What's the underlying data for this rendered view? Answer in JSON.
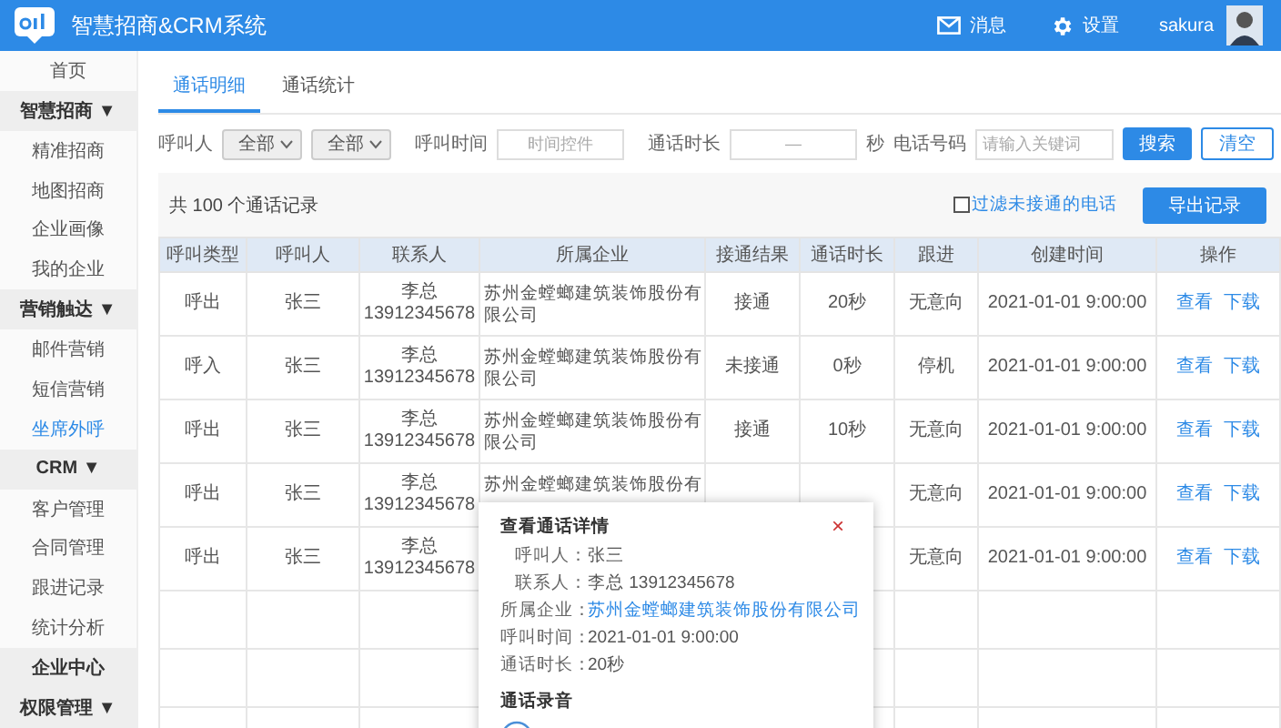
{
  "header": {
    "title": "智慧招商&CRM系统",
    "messages": "消息",
    "settings": "设置",
    "user": "sakura"
  },
  "sidebar": {
    "items": [
      {
        "label": "首页",
        "kind": "item",
        "selected": false
      },
      {
        "label": "智慧招商 ▼",
        "kind": "group",
        "selected": false
      },
      {
        "label": "精准招商",
        "kind": "item",
        "selected": false
      },
      {
        "label": "地图招商",
        "kind": "item",
        "selected": false
      },
      {
        "label": "企业画像",
        "kind": "item",
        "selected": false
      },
      {
        "label": "我的企业",
        "kind": "item",
        "selected": false
      },
      {
        "label": "营销触达 ▼",
        "kind": "group",
        "selected": false
      },
      {
        "label": "邮件营销",
        "kind": "item",
        "selected": false
      },
      {
        "label": "短信营销",
        "kind": "item",
        "selected": false
      },
      {
        "label": "坐席外呼",
        "kind": "item",
        "selected": true
      },
      {
        "label": "CRM ▼",
        "kind": "group",
        "selected": false
      },
      {
        "label": "客户管理",
        "kind": "item",
        "selected": false
      },
      {
        "label": "合同管理",
        "kind": "item",
        "selected": false
      },
      {
        "label": "跟进记录",
        "kind": "item",
        "selected": false
      },
      {
        "label": "统计分析",
        "kind": "item",
        "selected": false
      },
      {
        "label": "企业中心",
        "kind": "group",
        "selected": false
      },
      {
        "label": "权限管理 ▼",
        "kind": "group",
        "selected": false
      }
    ]
  },
  "tabs": [
    {
      "label": "通话明细",
      "selected": true
    },
    {
      "label": "通话统计",
      "selected": false
    }
  ],
  "filters": {
    "caller_label": "呼叫人",
    "select_1": "全部",
    "select_2": "全部",
    "time_label": "呼叫时间",
    "time_placeholder": "时间控件",
    "duration_label": "通话时长",
    "duration_placeholder": "—",
    "duration_unit": "秒",
    "phone_label": "电话号码",
    "phone_placeholder": "请输入关键词",
    "search": "搜索",
    "clear": "清空"
  },
  "summary": {
    "count": "共 100 个通话记录",
    "filter_unanswered": {
      "label": "过滤未接通的电话",
      "checked": false
    },
    "export": "导出记录"
  },
  "table": {
    "columns": [
      "呼叫类型",
      "呼叫人",
      "联系人",
      "所属企业",
      "接通结果",
      "通话时长",
      "跟进",
      "创建时间",
      "操作"
    ],
    "rows": [
      {
        "type": "呼出",
        "caller": "张三",
        "contact": "李总",
        "phone": "13912345678",
        "company": "苏州金螳螂建筑装饰股份有限公司",
        "result": "接通",
        "duration": "20秒",
        "follow": "无意向",
        "time": "2021-01-01  9:00:00",
        "actions": [
          "查看",
          "下载"
        ]
      },
      {
        "type": "呼入",
        "caller": "张三",
        "contact": "李总",
        "phone": "13912345678",
        "company": "苏州金螳螂建筑装饰股份有限公司",
        "result": "未接通",
        "duration": "0秒",
        "follow": "停机",
        "time": "2021-01-01  9:00:00",
        "actions": [
          "查看",
          "下载"
        ]
      },
      {
        "type": "呼出",
        "caller": "张三",
        "contact": "李总",
        "phone": "13912345678",
        "company": "苏州金螳螂建筑装饰股份有限公司",
        "result": "接通",
        "duration": "10秒",
        "follow": "无意向",
        "time": "2021-01-01  9:00:00",
        "actions": [
          "查看",
          "下载"
        ]
      },
      {
        "type": "呼出",
        "caller": "张三",
        "contact": "李总",
        "phone": "13912345678",
        "company": "苏州金螳螂建筑装饰股份有",
        "follow": "无意向",
        "time": "2021-01-01  9:00:00",
        "actions": [
          "查看",
          "下载"
        ]
      },
      {
        "type": "呼出",
        "caller": "张三",
        "contact": "李总",
        "phone": "13912345678",
        "follow": "无意向",
        "time": "2021-01-01  9:00:00",
        "actions": [
          "查看",
          "下载"
        ]
      }
    ]
  },
  "popup": {
    "title": "查看通话详情",
    "close": "×",
    "fields": [
      {
        "label": "呼叫人：",
        "value": "张三",
        "kind": "text"
      },
      {
        "label": "联系人：",
        "value": "李总 13912345678",
        "kind": "text"
      },
      {
        "label": "所属企业：",
        "value": "苏州金螳螂建筑装饰股份有限公司",
        "kind": "link"
      },
      {
        "label": "呼叫时间：",
        "value": "2021-01-01  9:00:00",
        "kind": "text"
      },
      {
        "label": "通话时长：",
        "value": "20秒",
        "kind": "text"
      }
    ],
    "recording_title": "通话录音"
  }
}
